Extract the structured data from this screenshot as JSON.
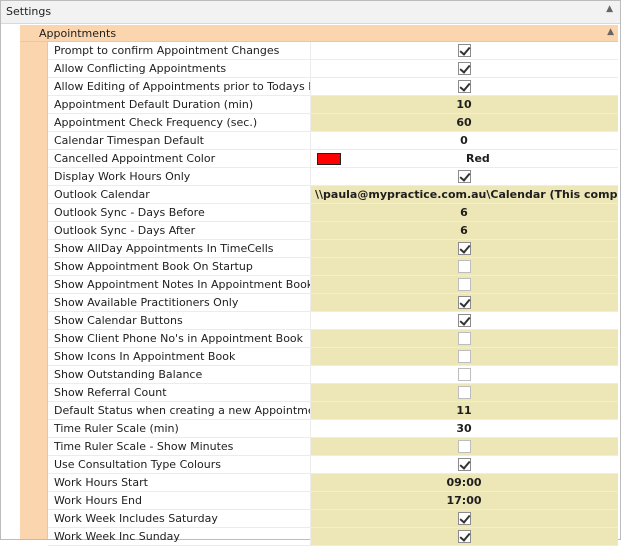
{
  "header": {
    "title": "Settings"
  },
  "category": {
    "title": "Appointments"
  },
  "rows": [
    {
      "name": "Prompt to confirm Appointment Changes",
      "type": "check",
      "checked": true,
      "changed": false
    },
    {
      "name": "Allow Conflicting Appointments",
      "type": "check",
      "checked": true,
      "changed": false
    },
    {
      "name": "Allow Editing of Appointments prior to Todays Date",
      "type": "check",
      "checked": true,
      "changed": false
    },
    {
      "name": "Appointment Default Duration (min)",
      "type": "number",
      "value": "10",
      "changed": true
    },
    {
      "name": "Appointment Check Frequency (sec.)",
      "type": "number",
      "value": "60",
      "changed": true
    },
    {
      "name": "Calendar Timespan Default",
      "type": "number",
      "value": "0",
      "changed": false
    },
    {
      "name": "Cancelled Appointment Color",
      "type": "color",
      "value": "Red",
      "color": "#ff0000",
      "changed": false
    },
    {
      "name": "Display Work Hours Only",
      "type": "check",
      "checked": true,
      "changed": false
    },
    {
      "name": "Outlook Calendar",
      "type": "text",
      "value": "\\\\paula@mypractice.com.au\\Calendar (This compu...",
      "changed": true
    },
    {
      "name": "Outlook Sync - Days Before",
      "type": "number",
      "value": "6",
      "changed": true
    },
    {
      "name": "Outlook Sync - Days After",
      "type": "number",
      "value": "6",
      "changed": true
    },
    {
      "name": "Show AllDay Appointments In TimeCells",
      "type": "check",
      "checked": true,
      "changed": true
    },
    {
      "name": "Show Appointment Book On Startup",
      "type": "check",
      "checked": false,
      "changed": true
    },
    {
      "name": "Show Appointment Notes In Appointment Book",
      "type": "check",
      "checked": false,
      "changed": true
    },
    {
      "name": "Show Available Practitioners Only",
      "type": "check",
      "checked": true,
      "changed": true
    },
    {
      "name": "Show Calendar Buttons",
      "type": "check",
      "checked": true,
      "changed": false
    },
    {
      "name": "Show Client Phone No's in Appointment Book",
      "type": "check",
      "checked": false,
      "changed": true
    },
    {
      "name": "Show Icons In Appointment Book",
      "type": "check",
      "checked": false,
      "changed": true
    },
    {
      "name": "Show Outstanding Balance",
      "type": "check",
      "checked": false,
      "changed": false
    },
    {
      "name": "Show Referral Count",
      "type": "check",
      "checked": false,
      "changed": true
    },
    {
      "name": "Default Status when creating a new Appointment",
      "type": "number",
      "value": "11",
      "changed": true
    },
    {
      "name": "Time Ruler Scale (min)",
      "type": "number",
      "value": "30",
      "changed": false
    },
    {
      "name": "Time Ruler Scale - Show Minutes",
      "type": "check",
      "checked": false,
      "changed": true
    },
    {
      "name": "Use Consultation Type Colours",
      "type": "check",
      "checked": true,
      "changed": false
    },
    {
      "name": "Work Hours Start",
      "type": "number",
      "value": "09:00",
      "changed": true
    },
    {
      "name": "Work Hours End",
      "type": "number",
      "value": "17:00",
      "changed": true
    },
    {
      "name": "Work Week Includes Saturday",
      "type": "check",
      "checked": true,
      "changed": true
    },
    {
      "name": "Work Week Inc Sunday",
      "type": "check",
      "checked": true,
      "changed": true
    }
  ]
}
